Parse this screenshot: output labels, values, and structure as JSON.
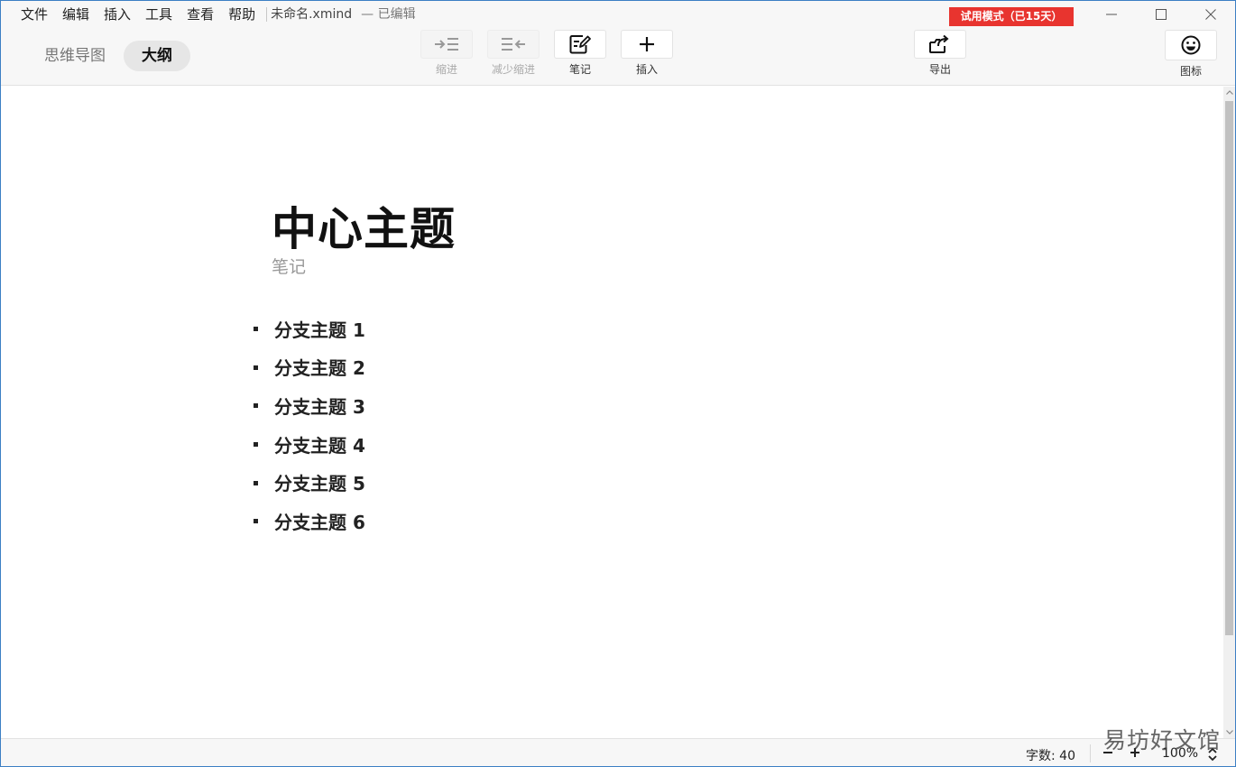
{
  "menubar": {
    "items": [
      "文件",
      "编辑",
      "插入",
      "工具",
      "查看",
      "帮助"
    ],
    "doc_title": "未命名.xmind",
    "doc_state": "— 已编辑"
  },
  "trial_badge": "试用模式（已15天）",
  "view_switch": {
    "mindmap": "思维导图",
    "outline": "大纲",
    "active": "outline"
  },
  "toolbar": {
    "indent": "缩进",
    "outdent": "减少缩进",
    "note": "笔记",
    "insert": "插入",
    "export": "导出",
    "icons": "图标"
  },
  "outline": {
    "central_topic": "中心主题",
    "central_note": "笔记",
    "branches": [
      "分支主题 1",
      "分支主题 2",
      "分支主题 3",
      "分支主题 4",
      "分支主题 5",
      "分支主题 6"
    ]
  },
  "statusbar": {
    "word_count": "字数: 40",
    "zoom": "100%"
  },
  "watermark": "易坊好文馆"
}
